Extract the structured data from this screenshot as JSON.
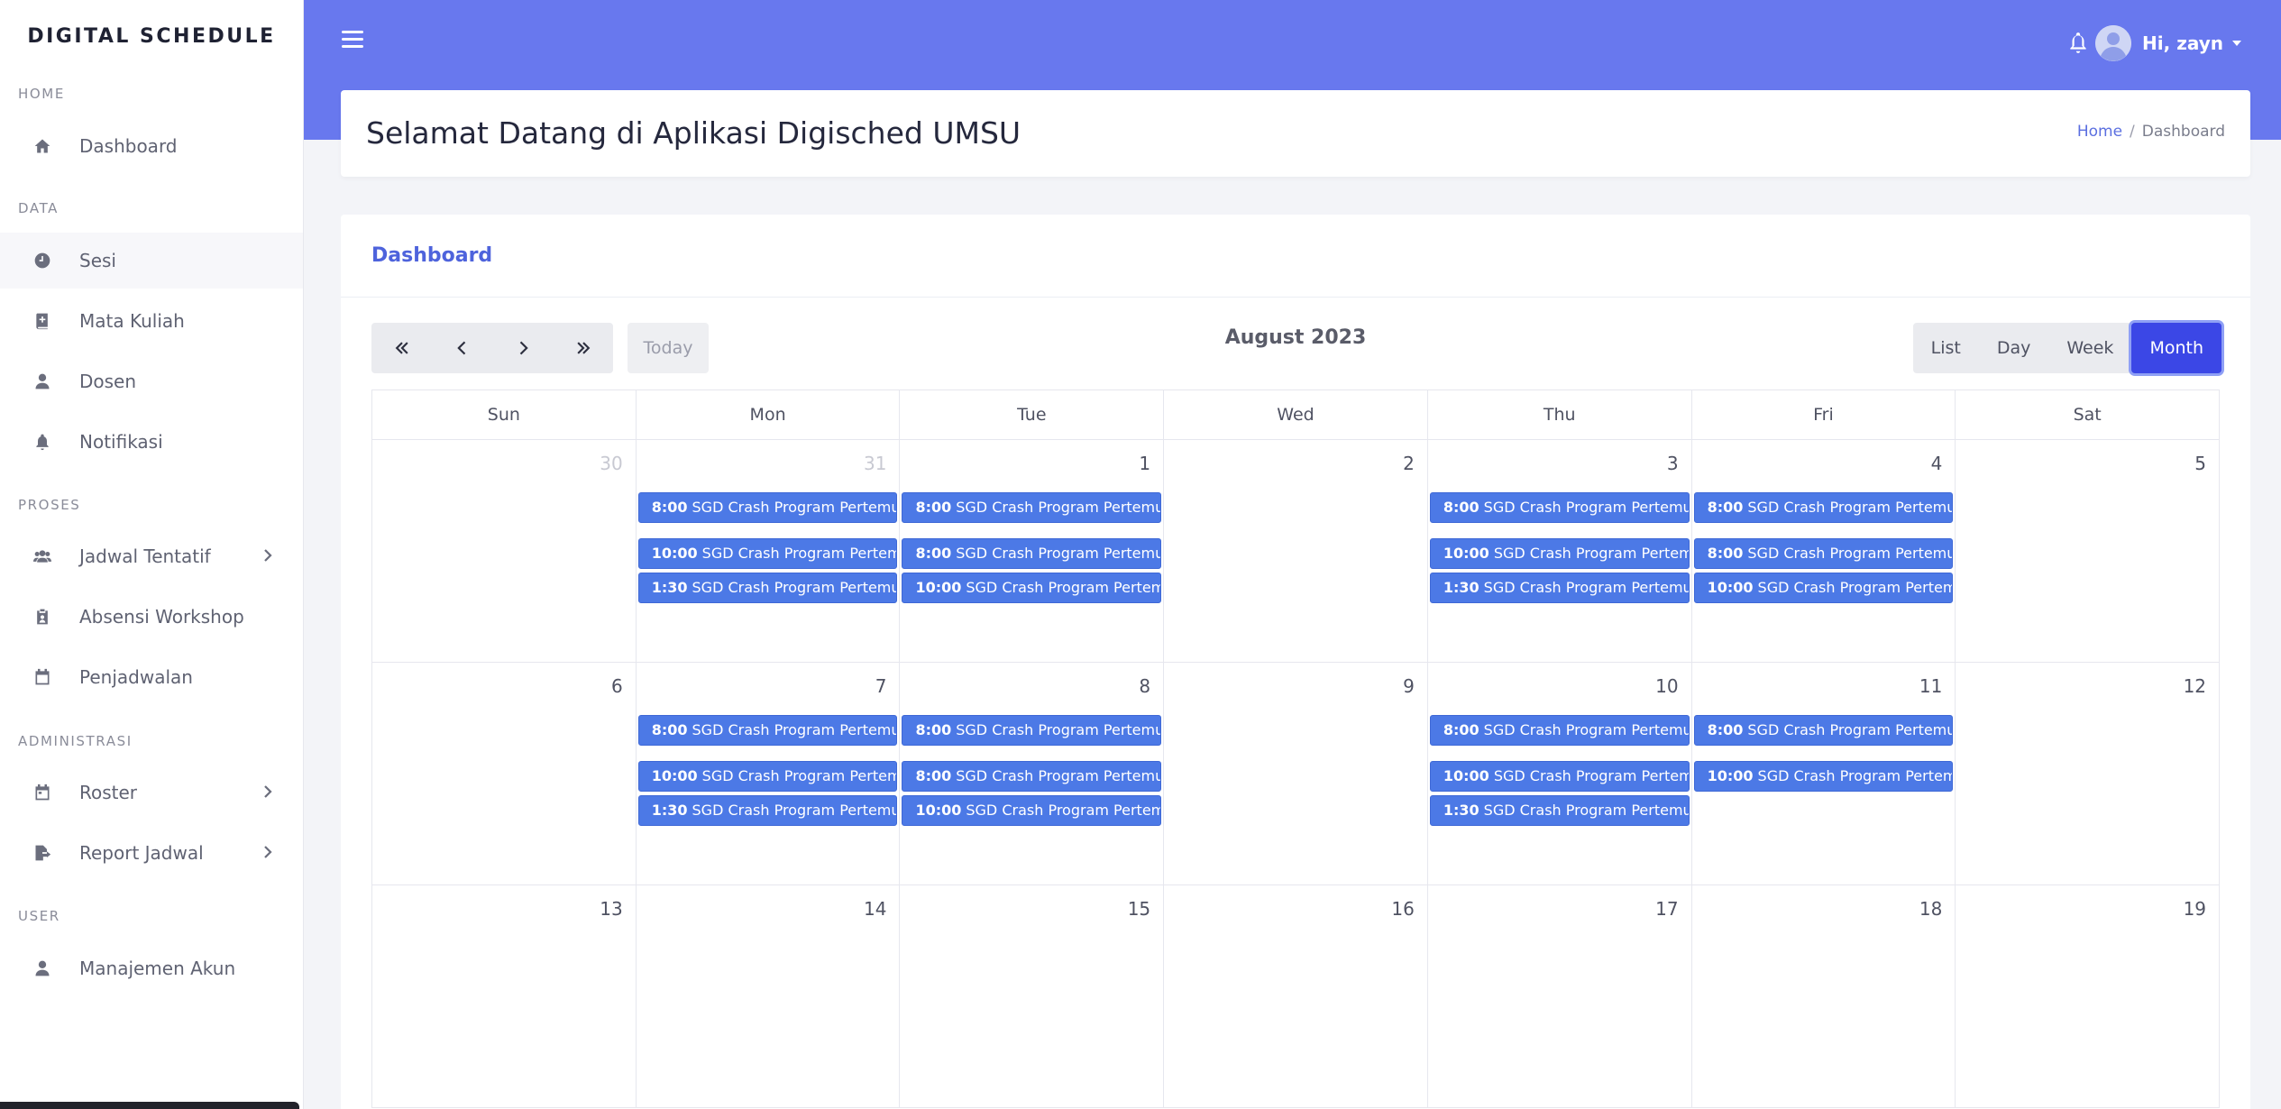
{
  "brand": "DIGITAL SCHEDULE",
  "sidebar": {
    "headings": [
      "HOME",
      "DATA",
      "PROSES",
      "ADMINISTRASI",
      "USER"
    ],
    "items": [
      {
        "label": "Dashboard",
        "icon": "home-icon"
      },
      {
        "label": "Sesi",
        "icon": "clock-icon"
      },
      {
        "label": "Mata Kuliah",
        "icon": "book-icon"
      },
      {
        "label": "Dosen",
        "icon": "user-icon"
      },
      {
        "label": "Notifikasi",
        "icon": "bell-icon"
      },
      {
        "label": "Jadwal Tentatif",
        "icon": "users-icon"
      },
      {
        "label": "Absensi Workshop",
        "icon": "clipboard-icon"
      },
      {
        "label": "Penjadwalan",
        "icon": "calendar-icon"
      },
      {
        "label": "Roster",
        "icon": "calendar-icon"
      },
      {
        "label": "Report Jadwal",
        "icon": "file-export-icon"
      },
      {
        "label": "Manajemen Akun",
        "icon": "user-icon"
      }
    ]
  },
  "topbar": {
    "greeting": "Hi, zayn"
  },
  "header": {
    "title": "Selamat Datang di Aplikasi Digisched UMSU",
    "breadcrumb_home": "Home",
    "breadcrumb_sep": "/",
    "breadcrumb_current": "Dashboard"
  },
  "card": {
    "title": "Dashboard"
  },
  "calendar": {
    "title": "August 2023",
    "today_label": "Today",
    "views": [
      "List",
      "Day",
      "Week",
      "Month"
    ],
    "active_view": "Month",
    "days_of_week": [
      "Sun",
      "Mon",
      "Tue",
      "Wed",
      "Thu",
      "Fri",
      "Sat"
    ],
    "event_label": "SGD Crash Program Pertemuan",
    "weeks": [
      {
        "days": [
          {
            "num": "30",
            "muted": true,
            "events": []
          },
          {
            "num": "31",
            "muted": true,
            "events": [
              "8:00",
              "10:00",
              "1:30"
            ]
          },
          {
            "num": "1",
            "events": [
              "8:00",
              "8:00",
              "10:00"
            ]
          },
          {
            "num": "2",
            "events": []
          },
          {
            "num": "3",
            "events": [
              "8:00",
              "10:00",
              "1:30"
            ]
          },
          {
            "num": "4",
            "events": [
              "8:00",
              "8:00",
              "10:00"
            ]
          },
          {
            "num": "5",
            "events": []
          }
        ]
      },
      {
        "days": [
          {
            "num": "6",
            "events": []
          },
          {
            "num": "7",
            "events": [
              "8:00",
              "10:00",
              "1:30"
            ]
          },
          {
            "num": "8",
            "events": [
              "8:00",
              "8:00",
              "10:00"
            ]
          },
          {
            "num": "9",
            "events": []
          },
          {
            "num": "10",
            "events": [
              "8:00",
              "10:00",
              "1:30"
            ]
          },
          {
            "num": "11",
            "events": [
              "8:00",
              "10:00"
            ]
          },
          {
            "num": "12",
            "events": []
          }
        ]
      },
      {
        "days": [
          {
            "num": "13",
            "events": []
          },
          {
            "num": "14",
            "events": []
          },
          {
            "num": "15",
            "events": []
          },
          {
            "num": "16",
            "events": []
          },
          {
            "num": "17",
            "events": []
          },
          {
            "num": "18",
            "events": []
          },
          {
            "num": "19",
            "events": []
          }
        ]
      }
    ]
  },
  "colors": {
    "accent": "#6878ee",
    "event": "#4c79e6",
    "active_view": "#3b47e6"
  }
}
